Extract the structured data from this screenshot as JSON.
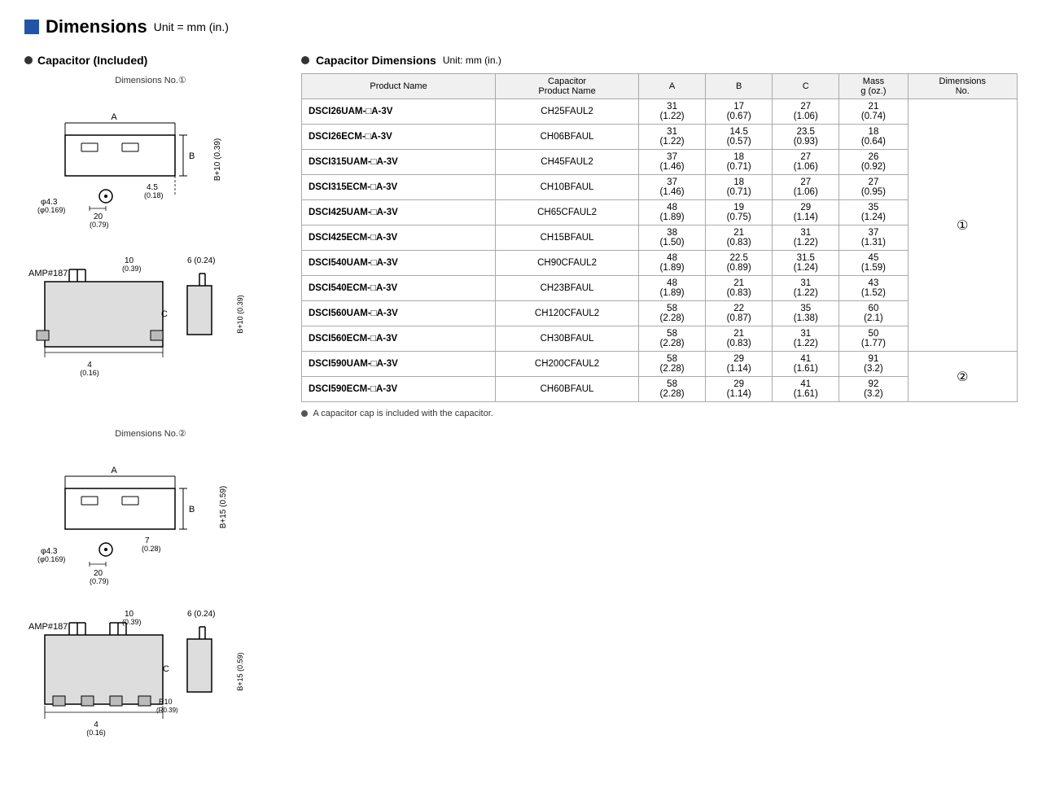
{
  "header": {
    "title": "Dimensions",
    "unit": "Unit = mm (in.)"
  },
  "left": {
    "section_title": "Capacitor (Included)",
    "dim1_label": "Dimensions No.①",
    "dim2_label": "Dimensions No.②"
  },
  "right": {
    "section_title": "Capacitor Dimensions",
    "unit": "Unit: mm (in.)",
    "table": {
      "headers": [
        "Product Name",
        "Capacitor\nProduct Name",
        "A",
        "B",
        "C",
        "Mass\ng (oz.)",
        "Dimensions\nNo."
      ],
      "rows": [
        {
          "product": "DSCI26UAM-□A-3V",
          "cap": "CH25FAUL2",
          "a": "31\n(1.22)",
          "b": "17\n(0.67)",
          "c": "27\n(1.06)",
          "mass": "21\n(0.74)",
          "dim_no": ""
        },
        {
          "product": "DSCI26ECM-□A-3V",
          "cap": "CH06BFAUL",
          "a": "31\n(1.22)",
          "b": "14.5\n(0.57)",
          "c": "23.5\n(0.93)",
          "mass": "18\n(0.64)",
          "dim_no": ""
        },
        {
          "product": "DSCI315UAM-□A-3V",
          "cap": "CH45FAUL2",
          "a": "37\n(1.46)",
          "b": "18\n(0.71)",
          "c": "27\n(1.06)",
          "mass": "26\n(0.92)",
          "dim_no": ""
        },
        {
          "product": "DSCI315ECM-□A-3V",
          "cap": "CH10BFAUL",
          "a": "37\n(1.46)",
          "b": "18\n(0.71)",
          "c": "27\n(1.06)",
          "mass": "27\n(0.95)",
          "dim_no": ""
        },
        {
          "product": "DSCI425UAM-□A-3V",
          "cap": "CH65CFAUL2",
          "a": "48\n(1.89)",
          "b": "19\n(0.75)",
          "c": "29\n(1.14)",
          "mass": "35\n(1.24)",
          "dim_no": "①"
        },
        {
          "product": "DSCI425ECM-□A-3V",
          "cap": "CH15BFAUL",
          "a": "38\n(1.50)",
          "b": "21\n(0.83)",
          "c": "31\n(1.22)",
          "mass": "37\n(1.31)",
          "dim_no": ""
        },
        {
          "product": "DSCI540UAM-□A-3V",
          "cap": "CH90CFAUL2",
          "a": "48\n(1.89)",
          "b": "22.5\n(0.89)",
          "c": "31.5\n(1.24)",
          "mass": "45\n(1.59)",
          "dim_no": ""
        },
        {
          "product": "DSCI540ECM-□A-3V",
          "cap": "CH23BFAUL",
          "a": "48\n(1.89)",
          "b": "21\n(0.83)",
          "c": "31\n(1.22)",
          "mass": "43\n(1.52)",
          "dim_no": ""
        },
        {
          "product": "DSCI560UAM-□A-3V",
          "cap": "CH120CFAUL2",
          "a": "58\n(2.28)",
          "b": "22\n(0.87)",
          "c": "35\n(1.38)",
          "mass": "60\n(2.1)",
          "dim_no": ""
        },
        {
          "product": "DSCI560ECM-□A-3V",
          "cap": "CH30BFAUL",
          "a": "58\n(2.28)",
          "b": "21\n(0.83)",
          "c": "31\n(1.22)",
          "mass": "50\n(1.77)",
          "dim_no": ""
        },
        {
          "product": "DSCI590UAM-□A-3V",
          "cap": "CH200CFAUL2",
          "a": "58\n(2.28)",
          "b": "29\n(1.14)",
          "c": "41\n(1.61)",
          "mass": "91\n(3.2)",
          "dim_no": "②"
        },
        {
          "product": "DSCI590ECM-□A-3V",
          "cap": "CH60BFAUL",
          "a": "58\n(2.28)",
          "b": "29\n(1.14)",
          "c": "41\n(1.61)",
          "mass": "92\n(3.2)",
          "dim_no": ""
        }
      ]
    },
    "footnote": "A capacitor cap is included with the capacitor."
  }
}
